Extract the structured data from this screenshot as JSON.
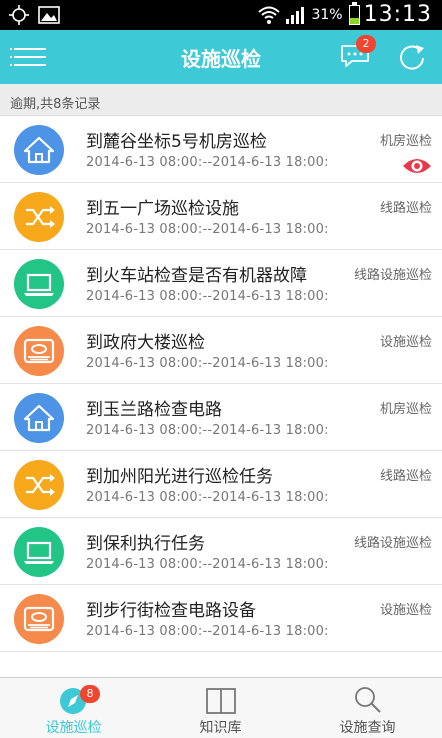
{
  "status_bar": {
    "battery": "31%",
    "time": "13:13"
  },
  "header": {
    "title": "设施巡检",
    "message_badge": "2"
  },
  "summary": "逾期,共8条记录",
  "colors": {
    "header": "#3dc9d6",
    "blue": "#4d93e6",
    "orange_yellow": "#f7a91b",
    "green": "#23c587",
    "orange": "#f58a4a",
    "badge": "#f0452f"
  },
  "list": [
    {
      "title": "到麓谷坐标5号机房巡检",
      "time": "2014-6-13 08:00:--2014-6-13 18:00:",
      "type": "机房巡检",
      "icon": "home-icon",
      "color": "#4d93e6",
      "has_eye": true
    },
    {
      "title": "到五一广场巡检设施",
      "time": "2014-6-13 08:00:--2014-6-13 18:00:",
      "type": "线路巡检",
      "icon": "shuffle-icon",
      "color": "#f7a91b",
      "has_eye": false
    },
    {
      "title": "到火车站检查是否有机器故障",
      "time": "2014-6-13 08:00:--2014-6-13 18:00:",
      "type": "线路设施巡检",
      "icon": "laptop-icon",
      "color": "#23c587",
      "has_eye": false
    },
    {
      "title": "到政府大楼巡检",
      "time": "2014-6-13 08:00:--2014-6-13 18:00:",
      "type": "设施巡检",
      "icon": "hard-drive-icon",
      "color": "#f58a4a",
      "has_eye": false
    },
    {
      "title": "到玉兰路检查电路",
      "time": "2014-6-13 08:00:--2014-6-13 18:00:",
      "type": "机房巡检",
      "icon": "home-icon",
      "color": "#4d93e6",
      "has_eye": false
    },
    {
      "title": "到加州阳光进行巡检任务",
      "time": "2014-6-13 08:00:--2014-6-13 18:00:",
      "type": "线路巡检",
      "icon": "shuffle-icon",
      "color": "#f7a91b",
      "has_eye": false
    },
    {
      "title": "到保利执行任务",
      "time": "2014-6-13 08:00:--2014-6-13 18:00:",
      "type": "线路设施巡检",
      "icon": "laptop-icon",
      "color": "#23c587",
      "has_eye": false
    },
    {
      "title": "到步行街检查电路设备",
      "time": "2014-6-13 08:00:--2014-6-13 18:00:",
      "type": "设施巡检",
      "icon": "hard-drive-icon",
      "color": "#f58a4a",
      "has_eye": false
    }
  ],
  "tabbar": {
    "tabs": [
      {
        "label": "设施巡检",
        "icon": "compass-icon",
        "active": true
      },
      {
        "label": "知识库",
        "icon": "book-icon",
        "active": false
      },
      {
        "label": "设施查询",
        "icon": "search-icon",
        "active": false
      }
    ],
    "badge": "8"
  }
}
